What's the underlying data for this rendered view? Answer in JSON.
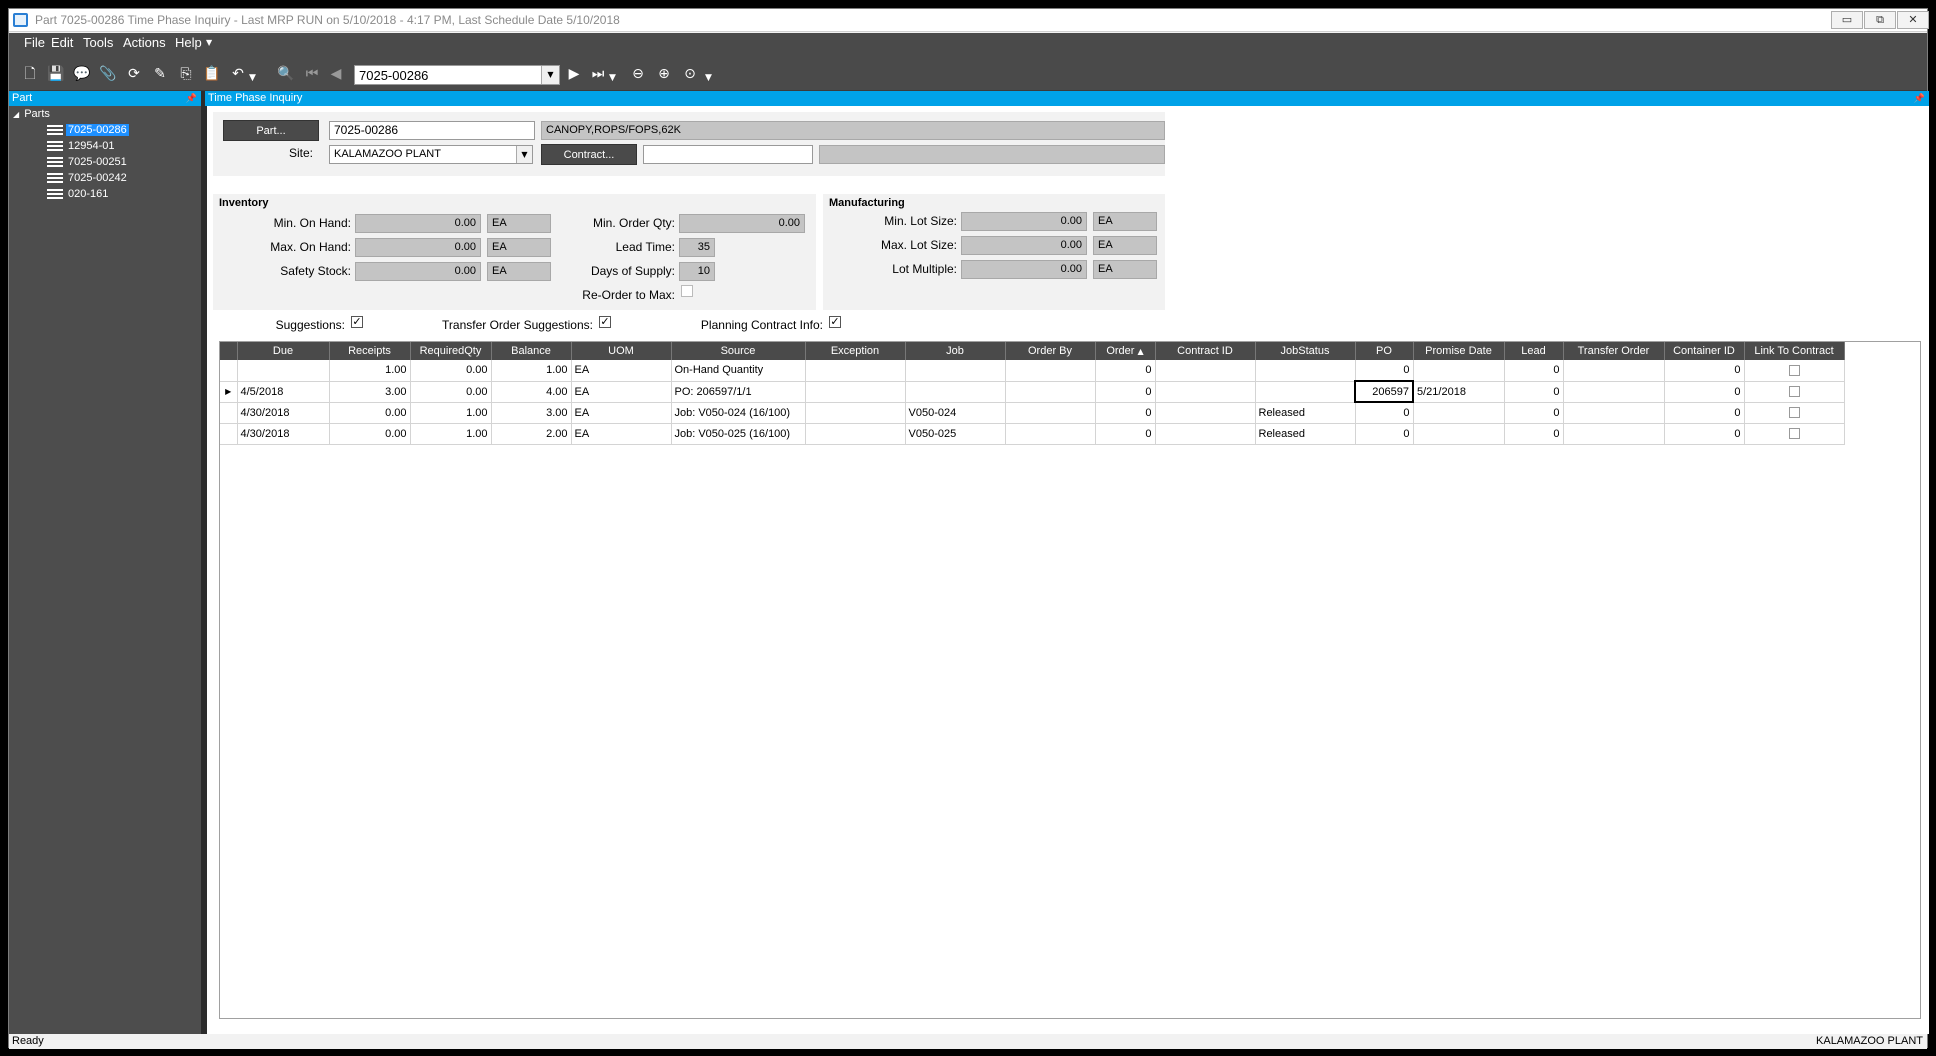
{
  "window": {
    "title": "Part 7025-00286 Time Phase Inquiry - Last MRP RUN on 5/10/2018 - 4:17 PM, Last Schedule Date  5/10/2018",
    "minimize_glyph": "▭",
    "restore_glyph": "⧉",
    "close_glyph": "✕"
  },
  "menu": {
    "file": "File",
    "edit": "Edit",
    "tools": "Tools",
    "actions": "Actions",
    "help": "Help"
  },
  "toolbar": {
    "part_value": "7025-00286",
    "dropdown_glyph": "▼"
  },
  "left_pane": {
    "header": "Part",
    "root": "Parts",
    "items": [
      "7025-00286",
      "12954-01",
      "7025-00251",
      "7025-00242",
      "020-161"
    ]
  },
  "main": {
    "header": "Time Phase Inquiry",
    "part_button": "Part...",
    "part_value": "7025-00286",
    "part_description": "CANOPY,ROPS/FOPS,62K",
    "site_label": "Site:",
    "site_value": "KALAMAZOO PLANT",
    "contract_button": "Contract...",
    "contract_value": "",
    "contract_description": ""
  },
  "inventory": {
    "title": "Inventory",
    "min_on_hand_label": "Min. On Hand:",
    "min_on_hand": "0.00",
    "min_on_hand_uom": "EA",
    "max_on_hand_label": "Max. On Hand:",
    "max_on_hand": "0.00",
    "max_on_hand_uom": "EA",
    "safety_stock_label": "Safety Stock:",
    "safety_stock": "0.00",
    "safety_stock_uom": "EA",
    "min_order_qty_label": "Min. Order Qty:",
    "min_order_qty": "0.00",
    "lead_time_label": "Lead Time:",
    "lead_time": "35",
    "days_supply_label": "Days of Supply:",
    "days_supply": "10",
    "reorder_label": "Re-Order to Max:"
  },
  "manufacturing": {
    "title": "Manufacturing",
    "min_lot_label": "Min. Lot Size:",
    "min_lot": "0.00",
    "min_lot_uom": "EA",
    "max_lot_label": "Max. Lot Size:",
    "max_lot": "0.00",
    "max_lot_uom": "EA",
    "lot_multiple_label": "Lot Multiple:",
    "lot_multiple": "0.00",
    "lot_multiple_uom": "EA"
  },
  "options": {
    "suggestions_label": "Suggestions:",
    "transfer_label": "Transfer Order Suggestions:",
    "planning_label": "Planning Contract Info:",
    "check_glyph": "✓"
  },
  "grid": {
    "columns": [
      "Due",
      "Receipts",
      "RequiredQty",
      "Balance",
      "UOM",
      "Source",
      "Exception",
      "Job",
      "Order By",
      "Order",
      "Contract ID",
      "JobStatus",
      "PO",
      "Promise Date",
      "Lead",
      "Transfer Order",
      "Container ID",
      "Link To Contract"
    ],
    "sort_glyph": "▲",
    "row_indicator": "▶",
    "rows": [
      [
        "",
        "1.00",
        "0.00",
        "1.00",
        "EA",
        "On-Hand Quantity",
        "",
        "",
        "",
        "0",
        "",
        "",
        "0",
        "",
        "0",
        "",
        "0",
        ""
      ],
      [
        "4/5/2018",
        "3.00",
        "0.00",
        "4.00",
        "EA",
        "PO: 206597/1/1",
        "",
        "",
        "",
        "0",
        "",
        "",
        "206597",
        "5/21/2018",
        "0",
        "",
        "0",
        ""
      ],
      [
        "4/30/2018",
        "0.00",
        "1.00",
        "3.00",
        "EA",
        "Job: V050-024 (16/100)",
        "",
        "V050-024",
        "",
        "0",
        "",
        "Released",
        "0",
        "",
        "0",
        "",
        "0",
        ""
      ],
      [
        "4/30/2018",
        "0.00",
        "1.00",
        "2.00",
        "EA",
        "Job: V050-025 (16/100)",
        "",
        "V050-025",
        "",
        "0",
        "",
        "Released",
        "0",
        "",
        "0",
        "",
        "0",
        ""
      ]
    ]
  },
  "status": {
    "left": "Ready",
    "right": "KALAMAZOO PLANT"
  }
}
